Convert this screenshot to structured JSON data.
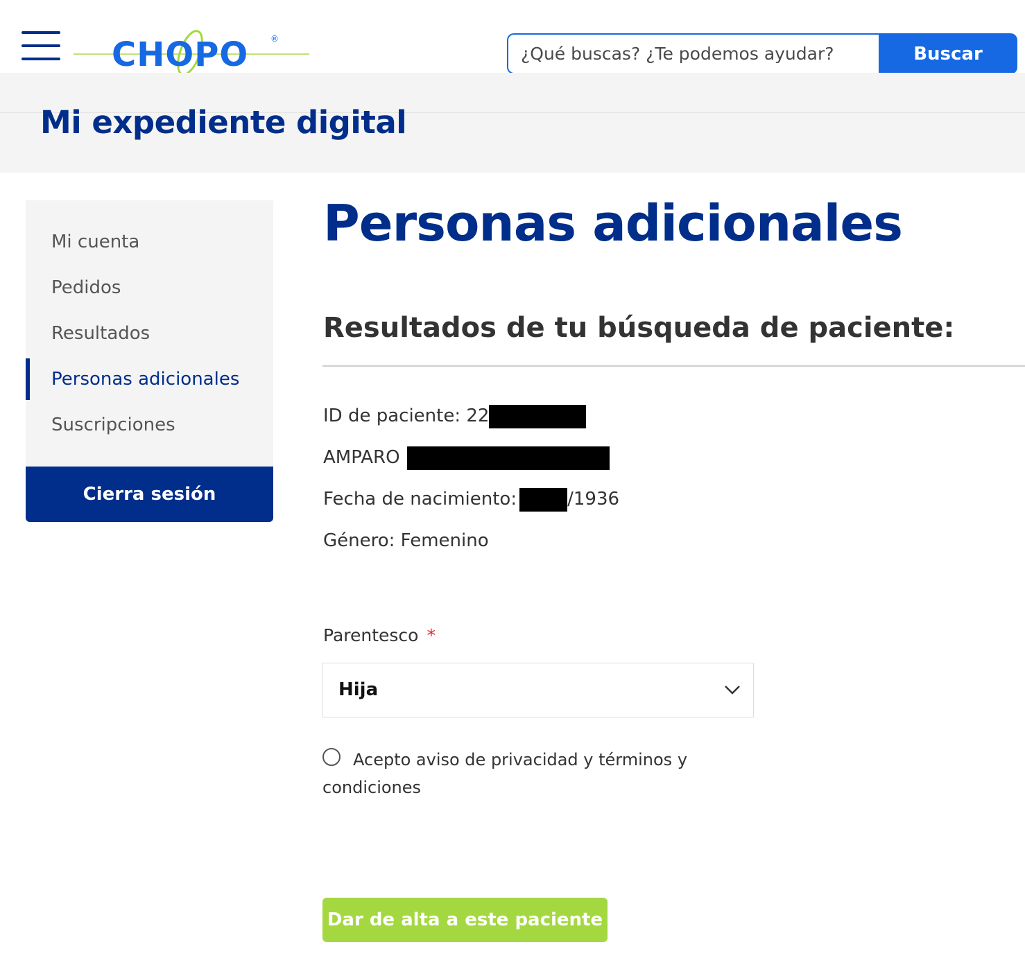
{
  "header": {
    "logo_text": "CHOPO",
    "registered_mark": "®",
    "search_placeholder": "¿Qué buscas? ¿Te podemos ayudar?",
    "search_button": "Buscar"
  },
  "banner": {
    "title": "Mi expediente digital"
  },
  "sidebar": {
    "items": [
      {
        "label": "Mi cuenta",
        "active": false
      },
      {
        "label": "Pedidos",
        "active": false
      },
      {
        "label": "Resultados",
        "active": false
      },
      {
        "label": "Personas adicionales",
        "active": true
      },
      {
        "label": "Suscripciones",
        "active": false
      }
    ],
    "logout_label": "Cierra sesión"
  },
  "main": {
    "page_title": "Personas adicionales",
    "section_title": "Resultados de tu búsqueda de paciente:",
    "patient": {
      "id_label": "ID de paciente: 22",
      "name": "AMPARO",
      "birth_label": "Fecha de nacimiento:",
      "birth_year": "/1936",
      "gender": "Género: Femenino"
    },
    "relationship": {
      "label": "Parentesco",
      "required_mark": "*",
      "selected": "Hija"
    },
    "terms_label": "Acepto aviso de privacidad y términos y condiciones",
    "submit_label": "Dar de alta a este paciente"
  },
  "colors": {
    "brand_blue": "#002E8A",
    "search_blue": "#1668E3",
    "submit_green": "#A4D841",
    "panel_gray": "#F4F4F4"
  }
}
